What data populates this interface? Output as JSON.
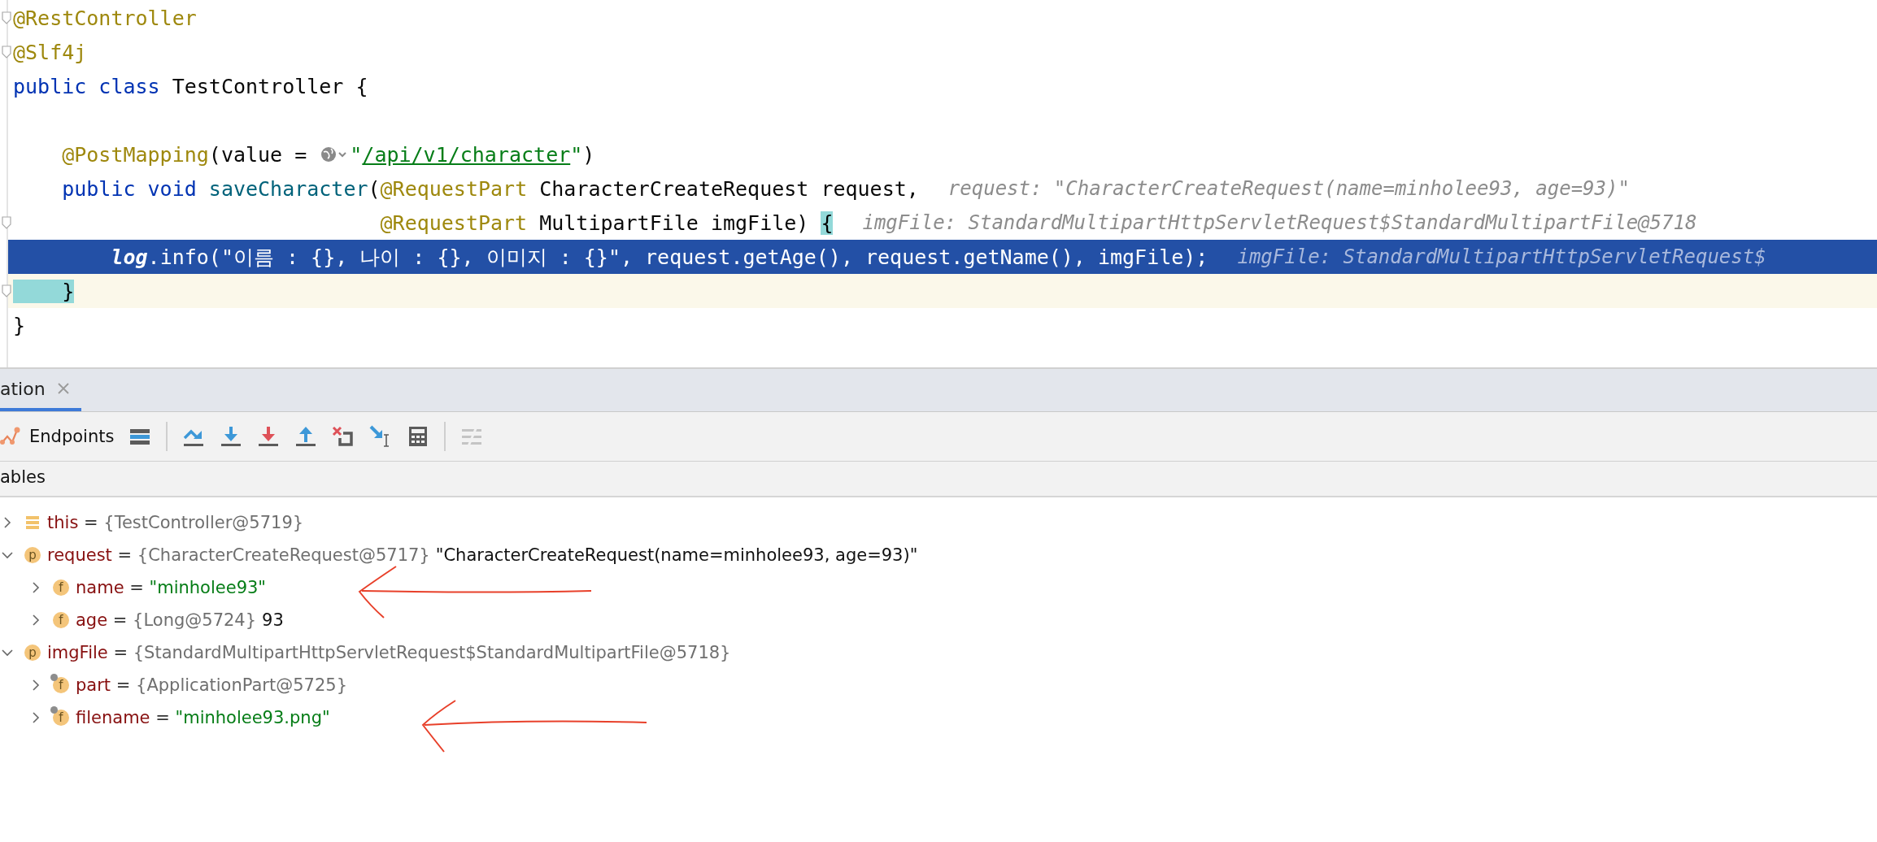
{
  "editor": {
    "lines": [
      {
        "fold": true,
        "current": false,
        "highlighted": false,
        "chunks": [
          {
            "kind": "code",
            "segments": [
              {
                "kind": "annotation",
                "text": "@RestController"
              }
            ]
          }
        ]
      },
      {
        "fold": true,
        "current": false,
        "highlighted": false,
        "chunks": [
          {
            "kind": "code",
            "segments": [
              {
                "kind": "annotation",
                "text": "@Slf4j"
              }
            ]
          }
        ]
      },
      {
        "fold": false,
        "current": false,
        "highlighted": false,
        "chunks": [
          {
            "kind": "code",
            "segments": [
              {
                "kind": "keyword",
                "text": "public class "
              },
              {
                "kind": "plain",
                "text": "TestController {"
              }
            ]
          }
        ]
      },
      {
        "fold": false,
        "current": false,
        "highlighted": false
      },
      {
        "fold": false,
        "current": false,
        "highlighted": false,
        "chunks": [
          {
            "kind": "code",
            "segments": [
              {
                "kind": "annotation",
                "text": "    @PostMapping"
              },
              {
                "kind": "plain",
                "text": "(value = "
              }
            ]
          },
          {
            "kind": "globe-icon"
          },
          {
            "kind": "code",
            "segments": [
              {
                "kind": "string",
                "text": "\""
              },
              {
                "kind": "link",
                "text": "/api/v1/character"
              },
              {
                "kind": "string",
                "text": "\""
              },
              {
                "kind": "plain",
                "text": ")"
              }
            ]
          }
        ]
      },
      {
        "fold": false,
        "current": false,
        "highlighted": false,
        "chunks": [
          {
            "kind": "code",
            "segments": [
              {
                "kind": "keyword",
                "text": "    public void "
              },
              {
                "kind": "method",
                "text": "saveCharacter"
              },
              {
                "kind": "plain",
                "text": "("
              },
              {
                "kind": "annotation",
                "text": "@RequestPart"
              },
              {
                "kind": "plain",
                "text": " CharacterCreateRequest request,"
              }
            ]
          },
          {
            "kind": "hint",
            "text": "request: \"CharacterCreateRequest(name=minholee93, age=93)\""
          }
        ]
      },
      {
        "fold": true,
        "current": false,
        "highlighted": false,
        "chunks": [
          {
            "kind": "code",
            "segments": [
              {
                "kind": "annotation",
                "text": "                              @RequestPart"
              },
              {
                "kind": "plain",
                "text": " MultipartFile imgFile) "
              },
              {
                "kind": "brace",
                "text": "{"
              }
            ]
          },
          {
            "kind": "hint",
            "text": "imgFile: StandardMultipartHttpServletRequest$StandardMultipartFile@5718"
          }
        ]
      },
      {
        "fold": false,
        "current": false,
        "highlighted": true,
        "chunks": [
          {
            "kind": "code",
            "segments": [
              {
                "kind": "static",
                "text": "        log"
              },
              {
                "kind": "plain",
                "text": ".info(\"이름 : {}, 나이 : {}, 이미지 : {}\", request.getAge(), request.getName(), imgFile);"
              }
            ]
          },
          {
            "kind": "hint",
            "text": "imgFile: StandardMultipartHttpServletRequest$"
          }
        ]
      },
      {
        "fold": true,
        "current": true,
        "highlighted": false,
        "chunks": [
          {
            "kind": "code",
            "segments": [
              {
                "kind": "brace",
                "text": "    }"
              }
            ]
          }
        ]
      },
      {
        "fold": false,
        "current": false,
        "highlighted": false,
        "chunks": [
          {
            "kind": "code",
            "segments": [
              {
                "kind": "plain",
                "text": "}"
              }
            ]
          }
        ]
      }
    ]
  },
  "debug": {
    "tab": {
      "label": "ation",
      "selected": true
    },
    "toolbar": {
      "endpoints": "Endpoints",
      "tools": [
        {
          "kind": "frames",
          "disabled": false
        },
        {
          "kind": "step-over",
          "disabled": false
        },
        {
          "kind": "step-into",
          "disabled": false
        },
        {
          "kind": "force-step-into",
          "disabled": false
        },
        {
          "kind": "step-out",
          "disabled": false
        },
        {
          "kind": "drop-frame",
          "disabled": false
        },
        {
          "kind": "run-to-cursor",
          "disabled": false
        },
        {
          "kind": "evaluate",
          "disabled": false
        },
        {
          "kind": "trace",
          "disabled": true
        }
      ]
    },
    "variables": {
      "header": "ables",
      "items": [
        {
          "kind": "object",
          "name": "this",
          "eq": "=",
          "ref": "{TestController@5719}",
          "expanded": false
        },
        {
          "kind": "parameter",
          "letter": "p",
          "name": "request",
          "eq": "=",
          "ref": "{CharacterCreateRequest@5717}",
          "value": "\"CharacterCreateRequest(name=minholee93, age=93)\"",
          "expanded": true,
          "children": [
            {
              "kind": "field",
              "letter": "f",
              "name": "name",
              "eq": "=",
              "string": "\"minholee93\"",
              "expanded": false
            },
            {
              "kind": "field",
              "letter": "f",
              "name": "age",
              "eq": "=",
              "ref": "{Long@5724}",
              "value": "93",
              "expanded": false
            }
          ]
        },
        {
          "kind": "parameter",
          "letter": "p",
          "name": "imgFile",
          "eq": "=",
          "ref": "{StandardMultipartHttpServletRequest$StandardMultipartFile@5718}",
          "expanded": true,
          "children": [
            {
              "kind": "field",
              "letter": "f",
              "pin": true,
              "name": "part",
              "eq": "=",
              "ref": "{ApplicationPart@5725}",
              "expanded": false
            },
            {
              "kind": "field",
              "letter": "f",
              "pin": true,
              "name": "filename",
              "eq": "=",
              "string": "\"minholee93.png\"",
              "expanded": false
            }
          ]
        }
      ]
    }
  }
}
